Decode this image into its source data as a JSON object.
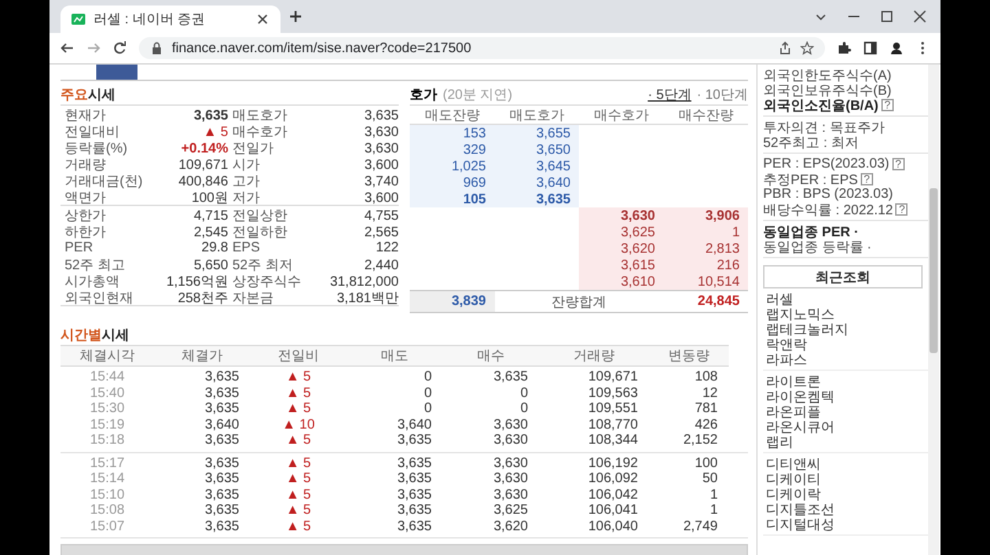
{
  "browser": {
    "tab_title": "러셀 : 네이버 증권",
    "url": "finance.naver.com/item/sise.naver?code=217500"
  },
  "main_quote": {
    "heading_accent": "주요",
    "heading": "시세",
    "sections": [
      [
        {
          "cells": [
            {
              "label": "현재가",
              "value": "3,635",
              "bold": true,
              "rising": false
            },
            {
              "label": "매도호가",
              "value": "3,635",
              "bold": false,
              "rising": false
            }
          ]
        },
        {
          "cells": [
            {
              "label": "전일대비",
              "value": "▲ 5",
              "bold": false,
              "rising": true
            },
            {
              "label": "매수호가",
              "value": "3,630",
              "bold": false,
              "rising": false
            }
          ]
        },
        {
          "cells": [
            {
              "label": "등락률(%)",
              "value": "+0.14%",
              "bold": true,
              "rising": true
            },
            {
              "label": "전일가",
              "value": "3,630",
              "bold": false,
              "rising": false
            }
          ]
        },
        {
          "cells": [
            {
              "label": "거래량",
              "value": "109,671",
              "bold": false,
              "rising": false
            },
            {
              "label": "시가",
              "value": "3,600",
              "bold": false,
              "rising": false
            }
          ]
        },
        {
          "cells": [
            {
              "label": "거래대금(천)",
              "value": "400,846",
              "bold": false,
              "rising": false
            },
            {
              "label": "고가",
              "value": "3,740",
              "bold": false,
              "rising": false
            }
          ]
        },
        {
          "cells": [
            {
              "label": "액면가",
              "value": "100원",
              "bold": false,
              "rising": false
            },
            {
              "label": "저가",
              "value": "3,600",
              "bold": false,
              "rising": false
            }
          ]
        }
      ],
      [
        {
          "cells": [
            {
              "label": "상한가",
              "value": "4,715",
              "bold": false,
              "rising": false
            },
            {
              "label": "전일상한",
              "value": "4,755",
              "bold": false,
              "rising": false
            }
          ]
        },
        {
          "cells": [
            {
              "label": "하한가",
              "value": "2,545",
              "bold": false,
              "rising": false
            },
            {
              "label": "전일하한",
              "value": "2,565",
              "bold": false,
              "rising": false
            }
          ]
        },
        {
          "cells": [
            {
              "label": "PER",
              "value": "29.8",
              "bold": false,
              "rising": false
            },
            {
              "label": "EPS",
              "value": "122",
              "bold": false,
              "rising": false
            }
          ]
        },
        {
          "cells": [
            {
              "label": "52주 최고",
              "value": "5,650",
              "bold": false,
              "rising": false
            },
            {
              "label": "52주 최저",
              "value": "2,440",
              "bold": false,
              "rising": false
            }
          ]
        },
        {
          "cells": [
            {
              "label": "시가총액",
              "value": "1,156억원",
              "bold": false,
              "rising": false
            },
            {
              "label": "상장주식수",
              "value": "31,812,000",
              "bold": false,
              "rising": false
            }
          ]
        },
        {
          "cells": [
            {
              "label": "외국인현재",
              "value": "258천주",
              "bold": false,
              "rising": false
            },
            {
              "label": "자본금",
              "value": "3,181백만",
              "bold": false,
              "rising": false
            }
          ]
        }
      ]
    ]
  },
  "order_book": {
    "heading": "호가",
    "note": "(20분 지연)",
    "depth_links": [
      {
        "label": "· 5단계",
        "selected": true
      },
      {
        "label": "· 10단계",
        "selected": false
      }
    ],
    "columns": [
      "매도잔량",
      "매도호가",
      "매수호가",
      "매수잔량"
    ],
    "asks": [
      {
        "volume": "153",
        "price": "3,655",
        "bold": false
      },
      {
        "volume": "329",
        "price": "3,650",
        "bold": false
      },
      {
        "volume": "1,025",
        "price": "3,645",
        "bold": false
      },
      {
        "volume": "969",
        "price": "3,640",
        "bold": false
      },
      {
        "volume": "105",
        "price": "3,635",
        "bold": true
      }
    ],
    "bids": [
      {
        "price": "3,630",
        "volume": "3,906",
        "bold": true
      },
      {
        "price": "3,625",
        "volume": "1",
        "bold": false
      },
      {
        "price": "3,620",
        "volume": "2,813",
        "bold": false
      },
      {
        "price": "3,615",
        "volume": "216",
        "bold": false
      },
      {
        "price": "3,610",
        "volume": "10,514",
        "bold": false
      }
    ],
    "total": {
      "ask_volume": "3,839",
      "label": "잔량합계",
      "bid_volume": "24,845"
    }
  },
  "time_quotes": {
    "heading_accent": "시간별",
    "heading": "시세",
    "columns": [
      "체결시각",
      "체결가",
      "전일비",
      "매도",
      "매수",
      "거래량",
      "변동량"
    ],
    "groups": [
      [
        {
          "time": "15:44",
          "price": "3,635",
          "change": "▲ 5",
          "sell": "0",
          "buy": "3,635",
          "volume": "109,671",
          "delta": "108"
        },
        {
          "time": "15:40",
          "price": "3,635",
          "change": "▲ 5",
          "sell": "0",
          "buy": "0",
          "volume": "109,563",
          "delta": "12"
        },
        {
          "time": "15:30",
          "price": "3,635",
          "change": "▲ 5",
          "sell": "0",
          "buy": "0",
          "volume": "109,551",
          "delta": "781"
        },
        {
          "time": "15:19",
          "price": "3,640",
          "change": "▲ 10",
          "sell": "3,640",
          "buy": "3,630",
          "volume": "108,770",
          "delta": "426"
        },
        {
          "time": "15:18",
          "price": "3,635",
          "change": "▲ 5",
          "sell": "3,635",
          "buy": "3,630",
          "volume": "108,344",
          "delta": "2,152"
        }
      ],
      [
        {
          "time": "15:17",
          "price": "3,635",
          "change": "▲ 5",
          "sell": "3,635",
          "buy": "3,630",
          "volume": "106,192",
          "delta": "100"
        },
        {
          "time": "15:14",
          "price": "3,635",
          "change": "▲ 5",
          "sell": "3,635",
          "buy": "3,630",
          "volume": "106,092",
          "delta": "50"
        },
        {
          "time": "15:10",
          "price": "3,635",
          "change": "▲ 5",
          "sell": "3,635",
          "buy": "3,630",
          "volume": "106,042",
          "delta": "1"
        },
        {
          "time": "15:08",
          "price": "3,635",
          "change": "▲ 5",
          "sell": "3,635",
          "buy": "3,625",
          "volume": "106,041",
          "delta": "1"
        },
        {
          "time": "15:07",
          "price": "3,635",
          "change": "▲ 5",
          "sell": "3,635",
          "buy": "3,620",
          "volume": "106,040",
          "delta": "2,749"
        }
      ]
    ]
  },
  "sidebar": {
    "info_groups": [
      [
        {
          "text": "외국인한도주식수(A)",
          "bold": false
        },
        {
          "text": "외국인보유주식수(B)",
          "bold": false
        },
        {
          "text": "외국인소진율(B/A)",
          "bold": true,
          "help": "?"
        }
      ],
      [
        {
          "text": "투자의견 : 목표주가",
          "bold": false
        },
        {
          "text": "52주최고 : 최저",
          "bold": false
        }
      ],
      [
        {
          "text": "PER : EPS(2023.03)",
          "bold": false,
          "help": "?"
        },
        {
          "text": "추정PER : EPS",
          "bold": false,
          "help": "?"
        },
        {
          "text": "PBR : BPS (2023.03)",
          "bold": false
        },
        {
          "text": "배당수익률 : 2022.12",
          "bold": false,
          "help": "?"
        }
      ],
      [
        {
          "text": "동일업종 PER ·",
          "bold": true
        },
        {
          "text": "동일업종 등락률 ·",
          "bold": false
        }
      ]
    ],
    "recent_title": "최근조회",
    "recent_groups": [
      [
        "러셀",
        "랩지노믹스",
        "랩테크놀러지",
        "락앤락",
        "라파스"
      ],
      [
        "라이트론",
        "라이온켐텍",
        "라온피플",
        "라온시큐어",
        "랩리"
      ],
      [
        "디티앤씨",
        "디케이티",
        "디케이락",
        "디지틀조선",
        "디지털대성"
      ]
    ]
  }
}
